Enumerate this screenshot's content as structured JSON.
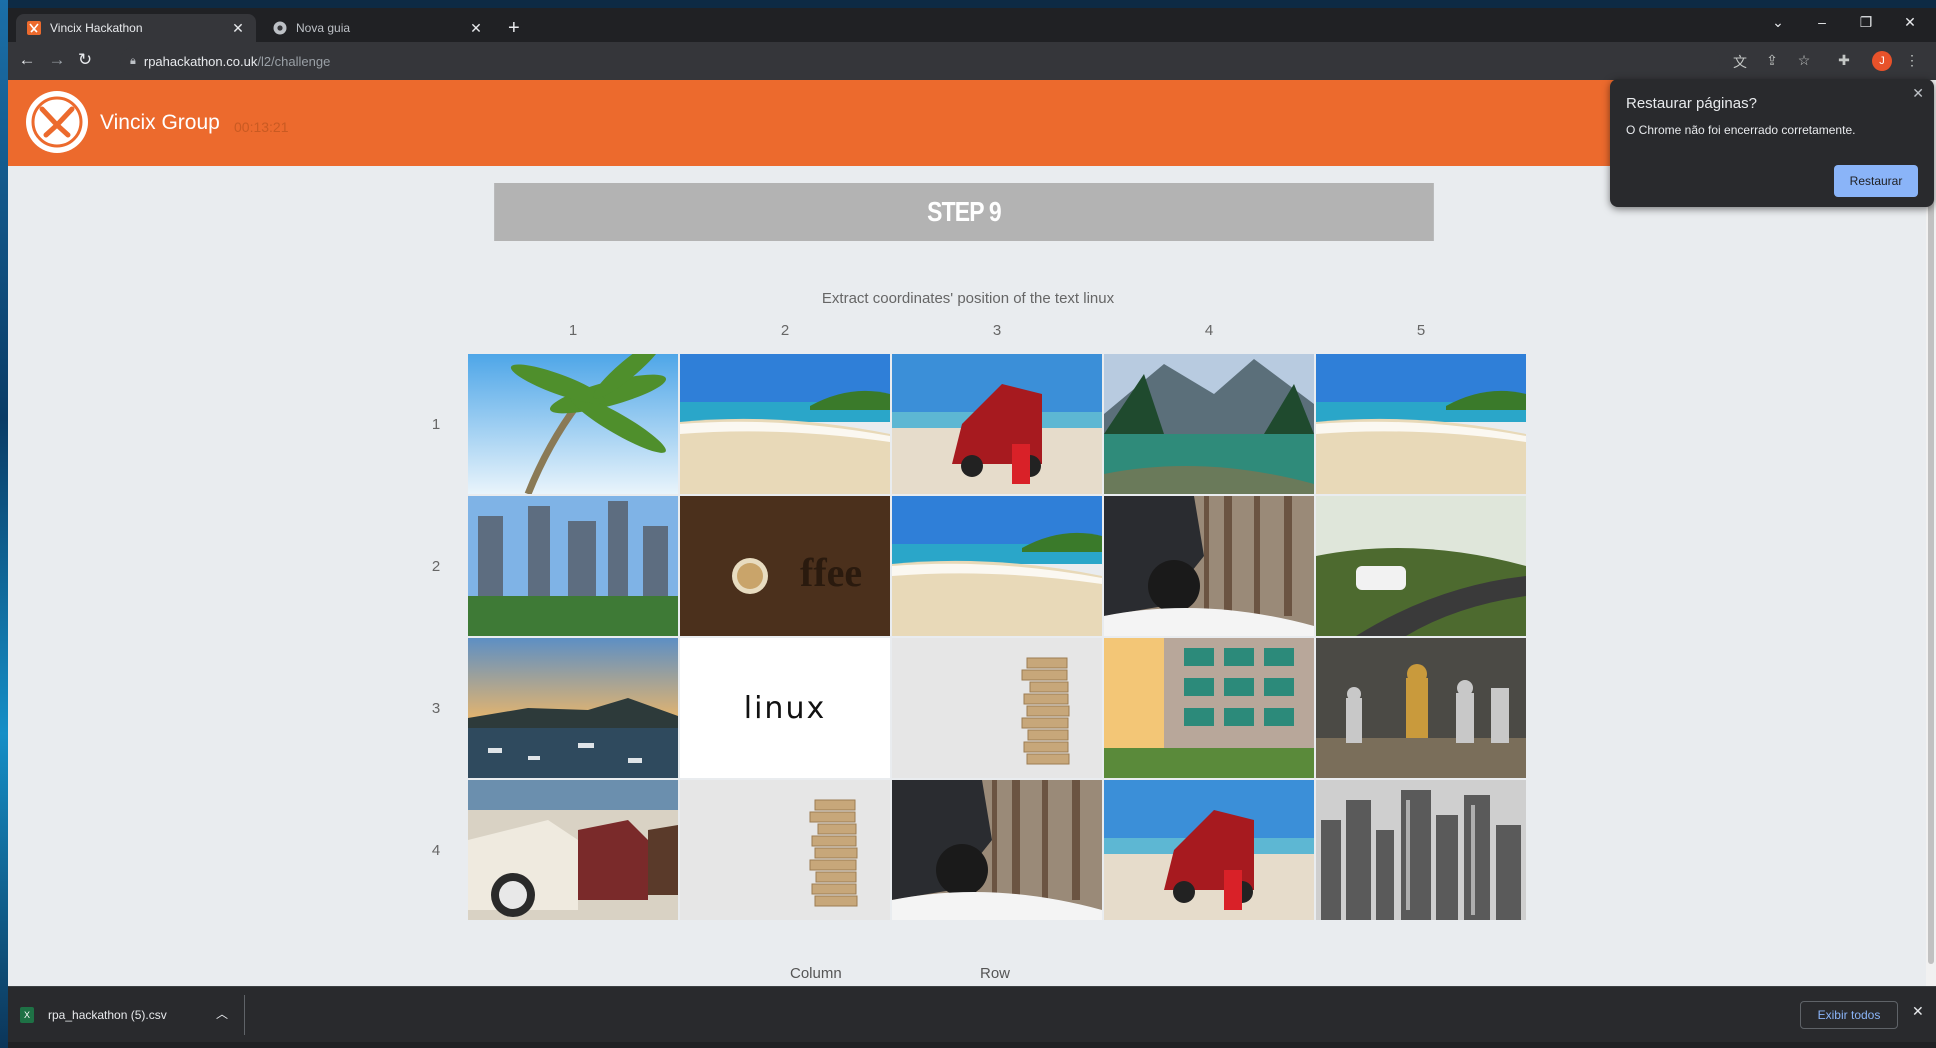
{
  "browser": {
    "tabs": [
      {
        "title": "Vincix Hackathon",
        "active": true
      },
      {
        "title": "Nova guia",
        "active": false
      }
    ],
    "new_tab_symbol": "+",
    "close_symbol": "✕",
    "url_host": "rpahackathon.co.uk",
    "url_path": "/l2/challenge",
    "avatar_letter": "J"
  },
  "site": {
    "brand": "Vincix Group",
    "timer": "00:13:21",
    "brand_color": "#ec6a2d"
  },
  "challenge": {
    "step_title": "STEP 9",
    "instruction": "Extract coordinates' position of the text linux",
    "columns": [
      "1",
      "2",
      "3",
      "4",
      "5"
    ],
    "rows": [
      "1",
      "2",
      "3",
      "4"
    ],
    "grid": [
      [
        "palm-tree",
        "beach",
        "red-car-beach",
        "mountain-lake",
        "beach"
      ],
      [
        "city-skyscrapers",
        "coffee-beans",
        "beach",
        "car-snow-forest",
        "white-suv-road"
      ],
      [
        "harbor-sunset",
        "linux",
        "jenga-tower",
        "apartment-sunset",
        "chess-pieces"
      ],
      [
        "vintage-cars",
        "jenga-tower",
        "car-snow-forest",
        "red-car-beach",
        "city-bw"
      ]
    ],
    "linux_text": "linux",
    "column_label": "Column",
    "row_label": "Row"
  },
  "popup": {
    "title": "Restaurar páginas?",
    "text": "O Chrome não foi encerrado corretamente.",
    "button": "Restaurar"
  },
  "download": {
    "filename": "rpa_hackathon (5).csv",
    "show_all": "Exibir todos"
  }
}
